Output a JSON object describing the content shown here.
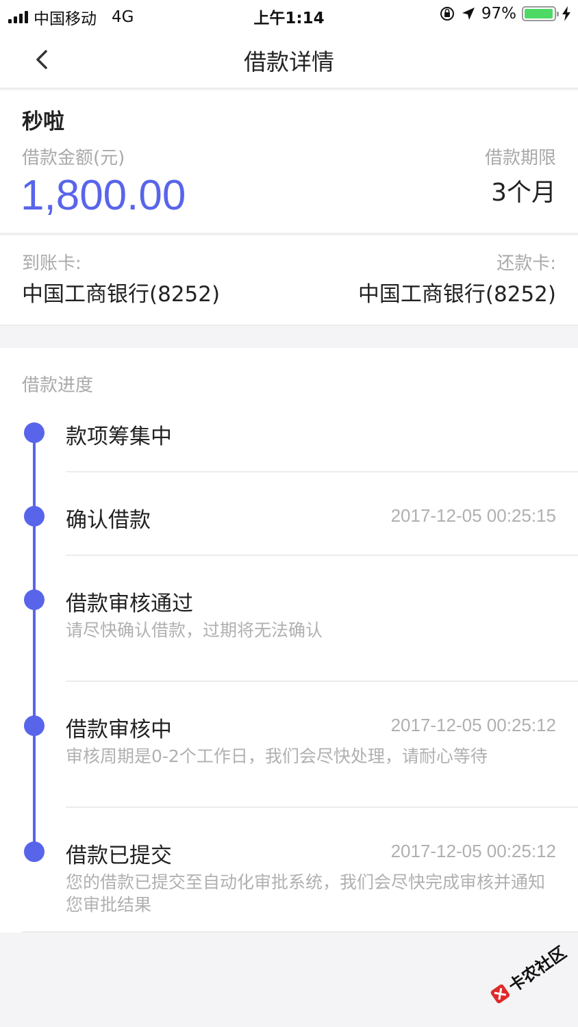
{
  "status_bar": {
    "carrier": "中国移动",
    "network": "4G",
    "time": "上午1:14",
    "battery_percent": "97%",
    "battery_level": 0.97,
    "battery_color": "#4cd964"
  },
  "nav": {
    "back_icon": "chevron-left-icon",
    "title": "借款详情"
  },
  "loan": {
    "product_name": "秒啦",
    "amount_label": "借款金额(元)",
    "amount": "1,800.00",
    "term_label": "借款期限",
    "term": "3个月",
    "receive_card_label": "到账卡:",
    "receive_card": "中国工商银行(8252)",
    "repay_card_label": "还款卡:",
    "repay_card": "中国工商银行(8252)"
  },
  "progress": {
    "title": "借款进度",
    "accent": "#5865ea",
    "steps": [
      {
        "title": "款项筹集中",
        "time": "",
        "desc": ""
      },
      {
        "title": "确认借款",
        "time": "2017-12-05 00:25:15",
        "desc": ""
      },
      {
        "title": "借款审核通过",
        "time": "",
        "desc": "请尽快确认借款，过期将无法确认"
      },
      {
        "title": "借款审核中",
        "time": "2017-12-05 00:25:12",
        "desc": "审核周期是0-2个工作日，我们会尽快处理，请耐心等待"
      },
      {
        "title": "借款已提交",
        "time": "2017-12-05 00:25:12",
        "desc": "您的借款已提交至自动化审批系统，我们会尽快完成审核并通知您审批结果"
      }
    ]
  },
  "watermark": {
    "text": "卡农社区"
  }
}
